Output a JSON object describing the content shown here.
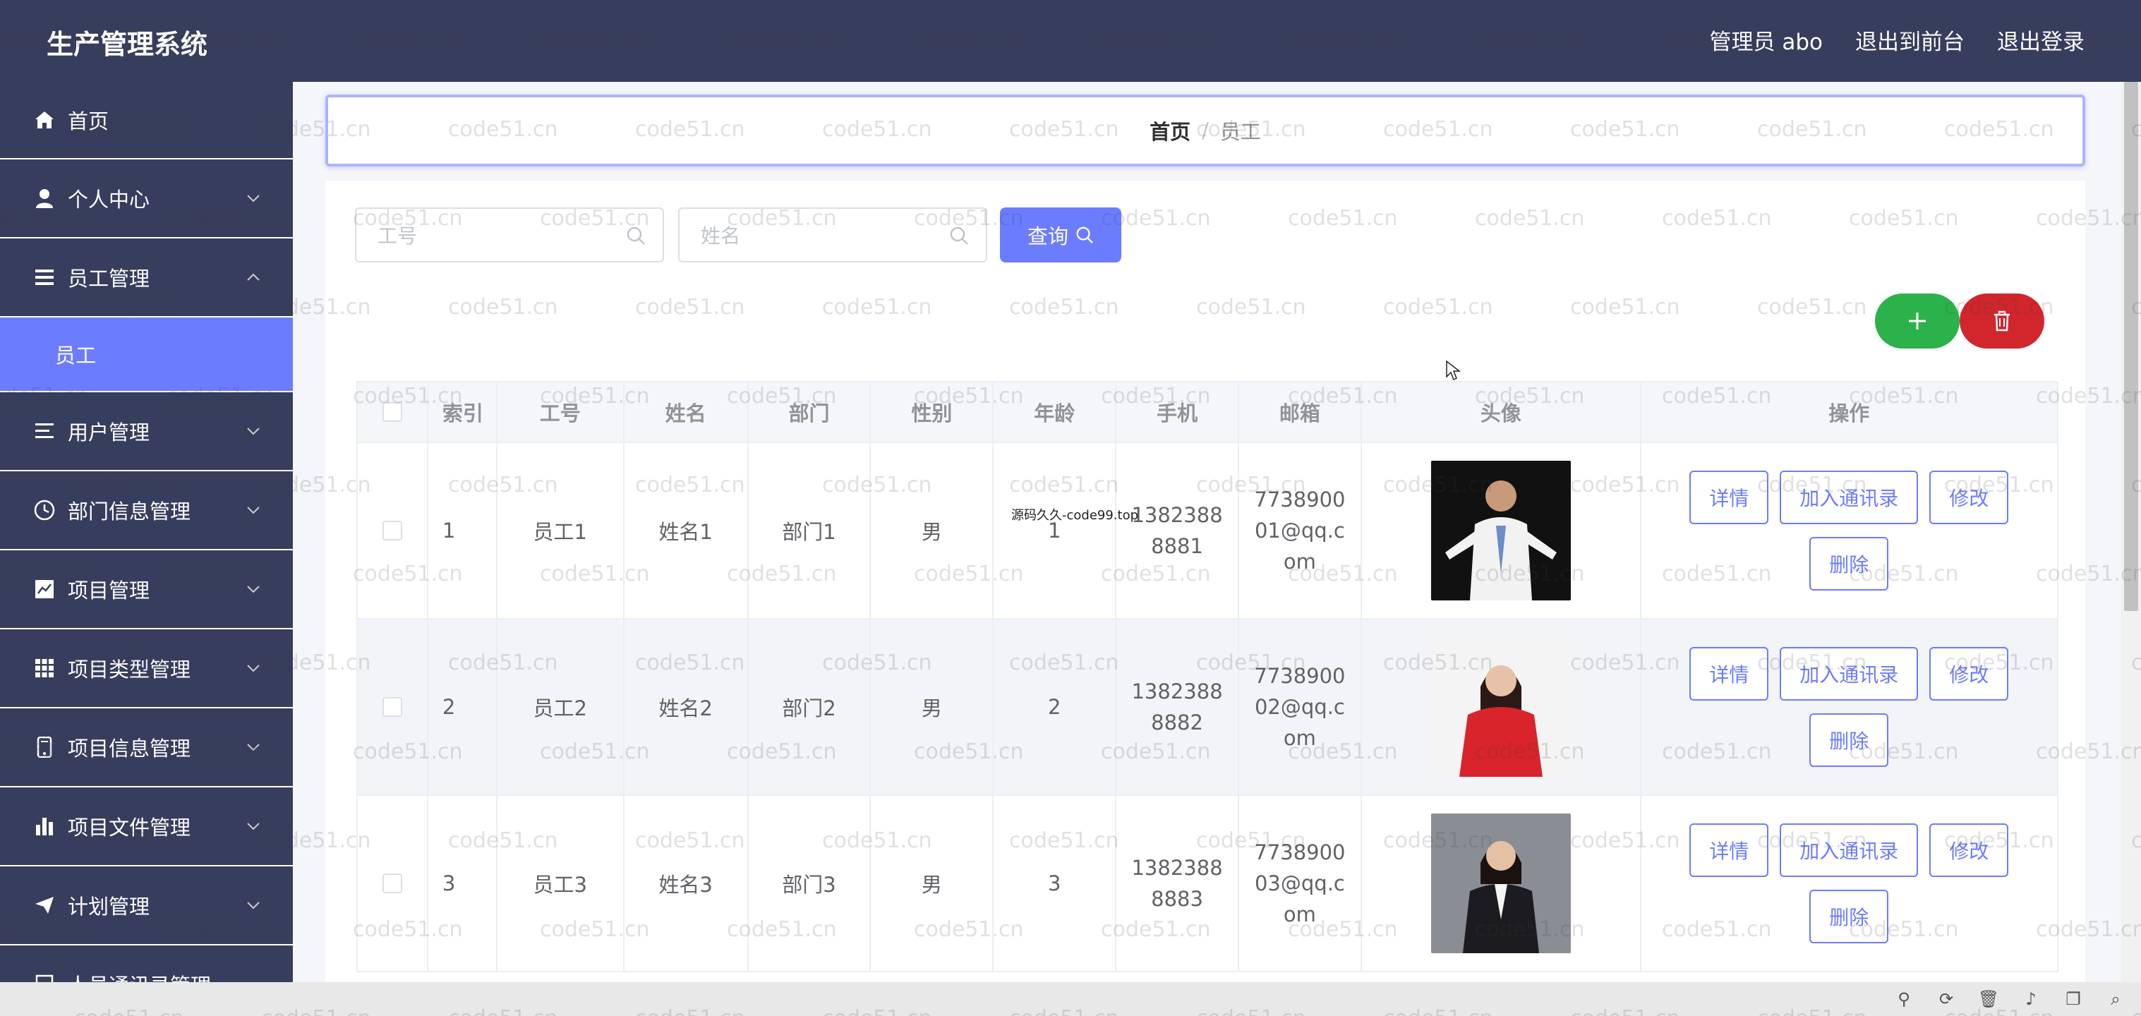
{
  "header": {
    "app_title": "生产管理系统",
    "admin_label": "管理员 abo",
    "exit_front": "退出到前台",
    "logout": "退出登录"
  },
  "sidebar": {
    "items": [
      {
        "label": "首页",
        "icon": "home-icon"
      },
      {
        "label": "个人中心",
        "icon": "user-icon"
      },
      {
        "label": "员工管理",
        "icon": "list-icon",
        "expanded": true
      },
      {
        "label": "用户管理",
        "icon": "menu-icon"
      },
      {
        "label": "部门信息管理",
        "icon": "clock-icon"
      },
      {
        "label": "项目管理",
        "icon": "chart-icon"
      },
      {
        "label": "项目类型管理",
        "icon": "grid-icon"
      },
      {
        "label": "项目信息管理",
        "icon": "mobile-icon"
      },
      {
        "label": "项目文件管理",
        "icon": "bar-icon"
      },
      {
        "label": "计划管理",
        "icon": "send-icon"
      },
      {
        "label": "人员通讯录管理",
        "icon": "book-icon"
      }
    ],
    "active_sub": "员工"
  },
  "breadcrumb": {
    "home": "首页",
    "separator": "/",
    "current": "员工"
  },
  "search": {
    "gonghao_placeholder": "工号",
    "xingming_placeholder": "姓名",
    "query_label": "查询"
  },
  "table": {
    "headers": [
      "索引",
      "工号",
      "姓名",
      "部门",
      "性别",
      "年龄",
      "手机",
      "邮箱",
      "头像",
      "操作"
    ],
    "rows": [
      {
        "index": "1",
        "gonghao": "员工1",
        "xingming": "姓名1",
        "bumen": "部门1",
        "xingbie": "男",
        "nianling": "1",
        "shouji": "13823888881",
        "youxiang": "773890001@qq.com"
      },
      {
        "index": "2",
        "gonghao": "员工2",
        "xingming": "姓名2",
        "bumen": "部门2",
        "xingbie": "男",
        "nianling": "2",
        "shouji": "13823888882",
        "youxiang": "773890002@qq.com"
      },
      {
        "index": "3",
        "gonghao": "员工3",
        "xingming": "姓名3",
        "bumen": "部门3",
        "xingbie": "男",
        "nianling": "3",
        "shouji": "13823888883",
        "youxiang": "773890003@qq.com"
      }
    ],
    "ops": {
      "detail": "详情",
      "add_contact": "加入通讯录",
      "edit": "修改",
      "delete": "删除"
    }
  },
  "overlay_note": "源码久久-code99.top",
  "watermark": "code51.cn",
  "colors": {
    "header_bg": "#373d5c",
    "accent": "#6c7cff",
    "add_green": "#2cb24a",
    "delete_red": "#d1262b"
  }
}
